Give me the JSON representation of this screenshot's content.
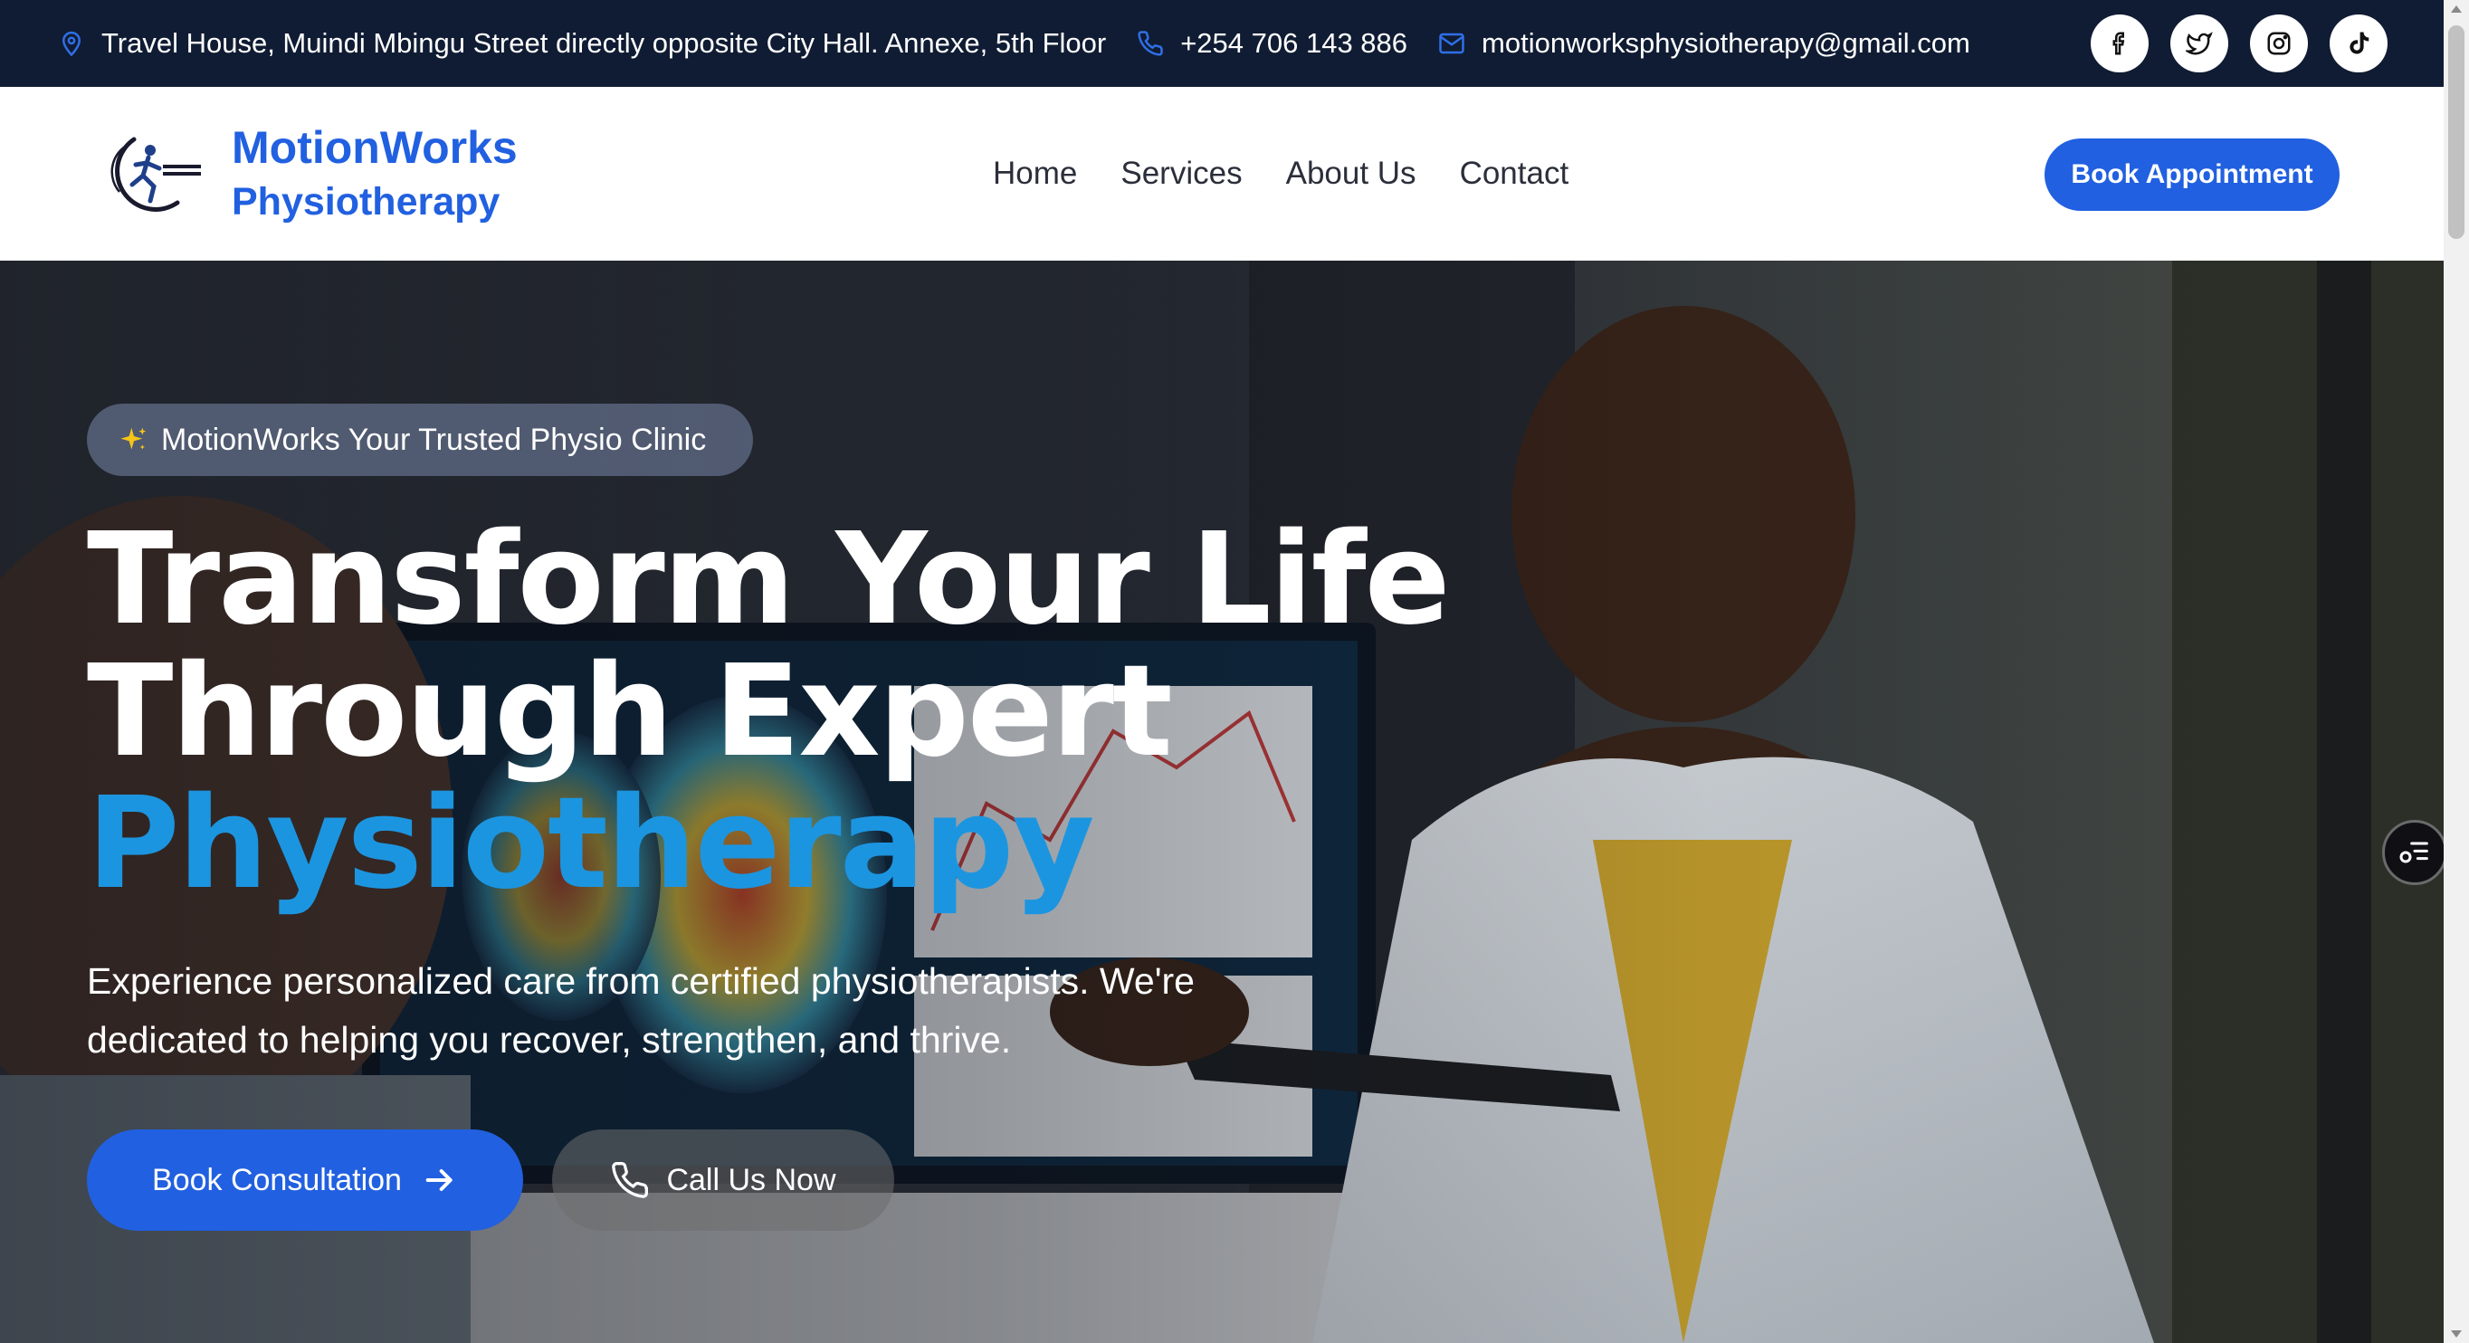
{
  "topbar": {
    "address": "Travel House, Muindi Mbingu Street directly opposite City Hall. Annexe, 5th Floor",
    "phone": "+254 706 143 886",
    "email": "motionworksphysiotherapy@gmail.com",
    "socials": [
      "facebook-icon",
      "twitter-icon",
      "instagram-icon",
      "tiktok-icon"
    ]
  },
  "header": {
    "brand_line1": "MotionWorks",
    "brand_line2": "Physiotherapy",
    "nav": [
      "Home",
      "Services",
      "About Us",
      "Contact"
    ],
    "cta": "Book Appointment"
  },
  "hero": {
    "badge": "MotionWorks Your Trusted Physio Clinic",
    "headline_line1": "Transform Your Life",
    "headline_line2": "Through Expert",
    "headline_accent": "Physiotherapy",
    "subtitle": "Experience personalized care from certified physiotherapists. We're dedicated to helping you recover, strengthen, and thrive.",
    "primary_cta": "Book Consultation",
    "secondary_cta": "Call Us Now"
  },
  "colors": {
    "topbar_bg": "#101c33",
    "brand_blue": "#2160e0",
    "accent_blue": "#1c95e0"
  }
}
